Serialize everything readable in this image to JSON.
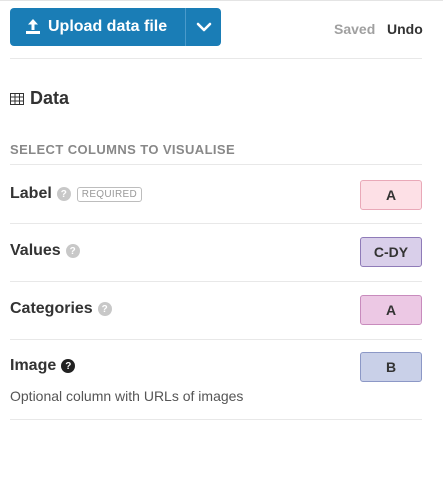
{
  "toolbar": {
    "upload_label": "Upload data file",
    "upload_icon": "upload-icon",
    "dropdown_icon": "chevron-down-icon",
    "saved_label": "Saved",
    "undo_label": "Undo",
    "accent": "#1a7db6"
  },
  "data_section": {
    "icon": "table-icon",
    "title": "Data",
    "section_label": "SELECT COLUMNS TO VISUALISE"
  },
  "columns": [
    {
      "label": "Label",
      "required_badge": "REQUIRED",
      "value": "A",
      "color": "#fde0e6",
      "border": "#e9a9b8"
    },
    {
      "label": "Values",
      "value": "C-DY",
      "color": "#d9cfea",
      "border": "#8f7bb8"
    },
    {
      "label": "Categories",
      "value": "A",
      "color": "#ecc8e4",
      "border": "#c88bbd"
    },
    {
      "label": "Image",
      "value": "B",
      "color": "#c9d0e8",
      "border": "#8c98c6",
      "hint": "Optional column with URLs of images"
    }
  ]
}
